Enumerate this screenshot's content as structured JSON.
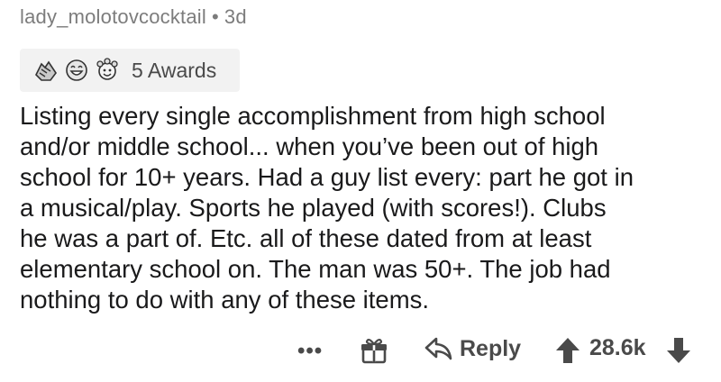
{
  "comment": {
    "author": "lady_molotovcocktail",
    "separator": "•",
    "age": "3d",
    "awards": {
      "icons": [
        "hands-award-icon",
        "laughing-face-award-icon",
        "wholesome-award-icon"
      ],
      "label": "5 Awards"
    },
    "body": "Listing every single accomplishment from high school\nand/or middle school... when you’ve been out of high\nschool for 10+ years. Had a guy list every: part he got in\na musical/play. Sports he played (with scores!). Clubs\nhe was a part of. Etc. all of these dated from at least\nelementary school on. The man was 50+. The job had\nnothing to do with any of these items.",
    "actions": {
      "more": "•••",
      "reply": "Reply",
      "score": "28.6k"
    }
  }
}
